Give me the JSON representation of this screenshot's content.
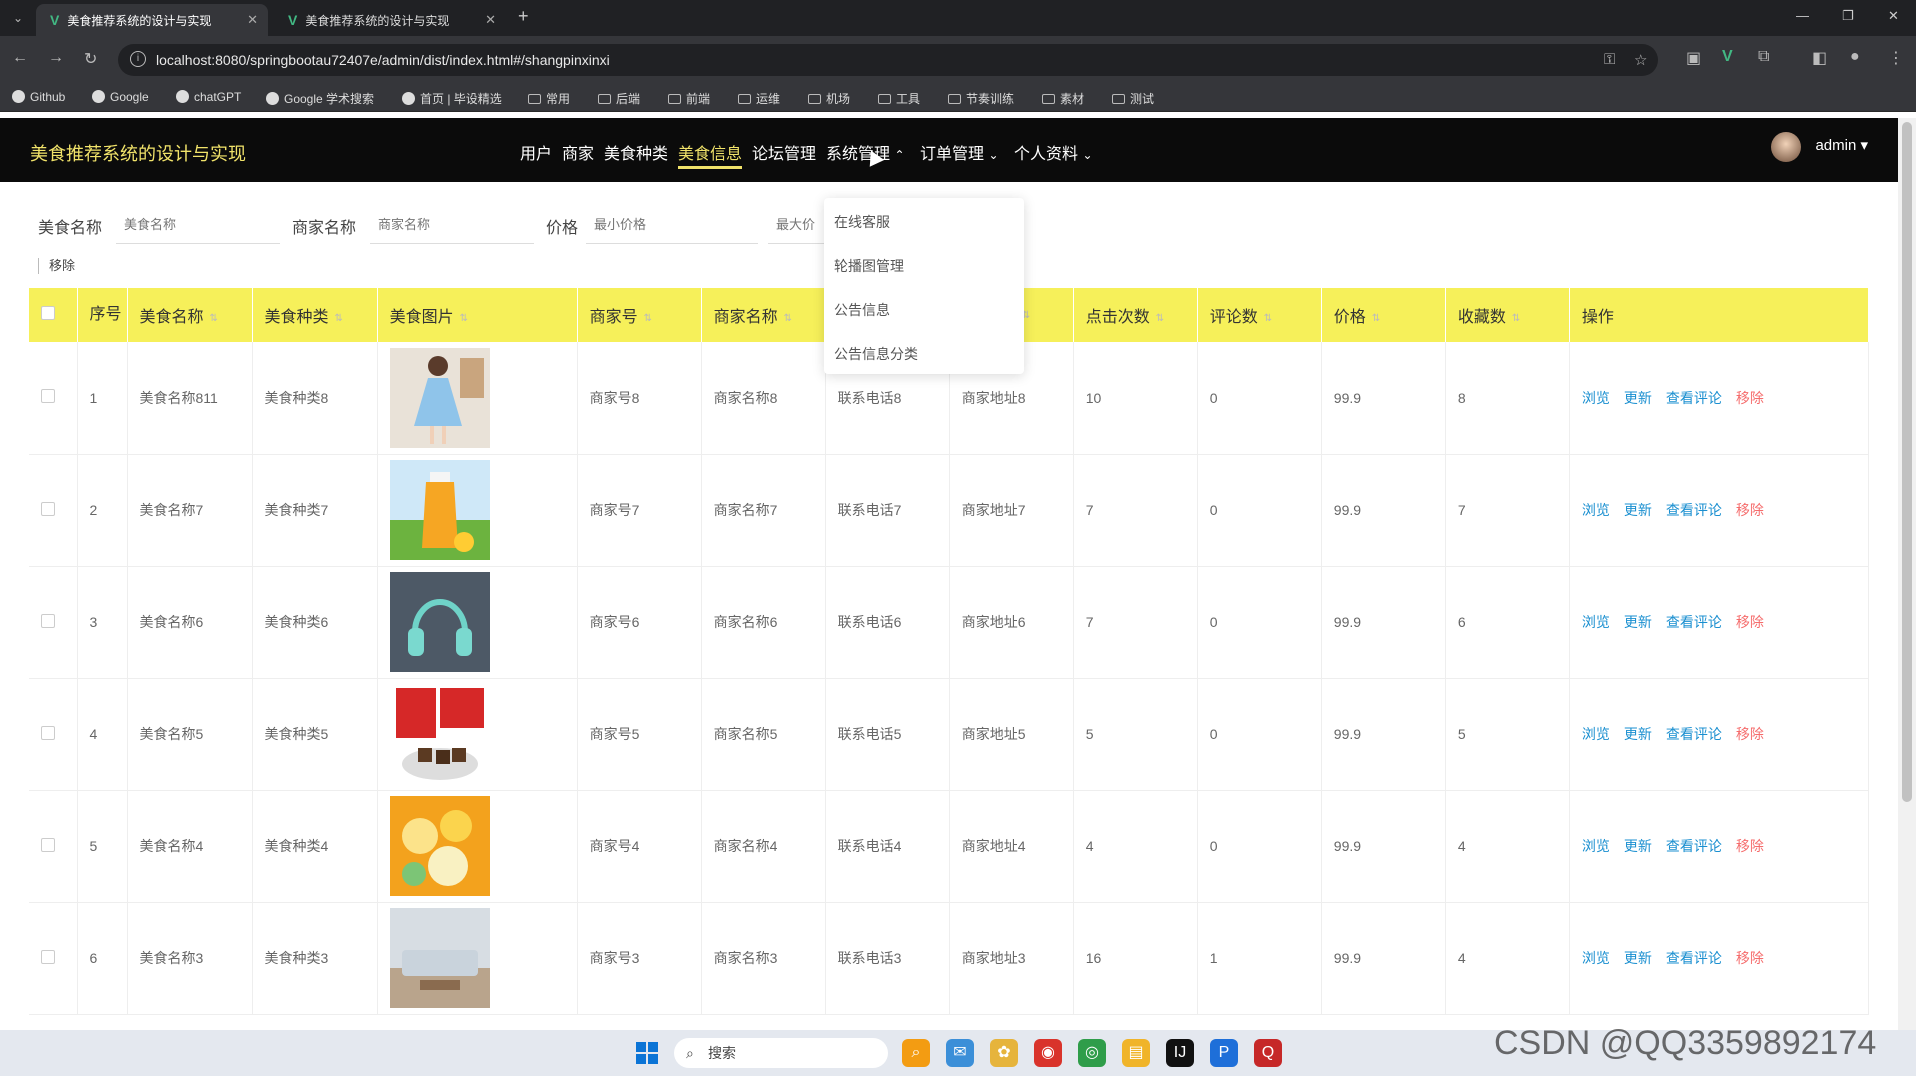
{
  "browser": {
    "tabs": [
      {
        "title": "美食推荐系统的设计与实现",
        "active": true
      },
      {
        "title": "美食推荐系统的设计与实现",
        "active": false
      }
    ],
    "url": "localhost:8080/springbootau72407e/admin/dist/index.html#/shangpinxinxi",
    "bookmarks": [
      "Github",
      "Google",
      "chatGPT",
      "Google 学术搜索",
      "首页 | 毕设精选",
      "常用",
      "后端",
      "前端",
      "运维",
      "机场",
      "工具",
      "节奏训练",
      "素材",
      "测试"
    ]
  },
  "app": {
    "title": "美食推荐系统的设计与实现",
    "nav": [
      {
        "label": "用户"
      },
      {
        "label": "商家"
      },
      {
        "label": "美食种类"
      },
      {
        "label": "美食信息",
        "active": true
      },
      {
        "label": "论坛管理"
      },
      {
        "label": "系统管理",
        "arrow": "⌃"
      },
      {
        "label": "订单管理",
        "arrow": "⌄"
      },
      {
        "label": "个人资料",
        "arrow": "⌄"
      }
    ],
    "user": "admin ▾",
    "dropdown": [
      "在线客服",
      "轮播图管理",
      "公告信息",
      "公告信息分类"
    ]
  },
  "search": {
    "food_label": "美食名称",
    "food_placeholder": "美食名称",
    "shop_label": "商家名称",
    "shop_placeholder": "商家名称",
    "price_label": "价格",
    "min_placeholder": "最小价格",
    "max_placeholder": "最大价"
  },
  "toolbar": {
    "remove": "移除"
  },
  "table": {
    "headers": [
      "序号",
      "美食名称",
      "美食种类",
      "美食图片",
      "商家号",
      "商家名称",
      "",
      "",
      "点击次数",
      "评论数",
      "价格",
      "收藏数",
      "操作"
    ],
    "rows": [
      {
        "no": "1",
        "name": "美食名称811",
        "type": "美食种类8",
        "img": "dress",
        "shop_no": "商家号8",
        "shop": "商家名称8",
        "phone": "联系电话8",
        "addr": "商家地址8",
        "clicks": "10",
        "comments": "0",
        "price": "99.9",
        "fav": "8"
      },
      {
        "no": "2",
        "name": "美食名称7",
        "type": "美食种类7",
        "img": "juice",
        "shop_no": "商家号7",
        "shop": "商家名称7",
        "phone": "联系电话7",
        "addr": "商家地址7",
        "clicks": "7",
        "comments": "0",
        "price": "99.9",
        "fav": "7"
      },
      {
        "no": "3",
        "name": "美食名称6",
        "type": "美食种类6",
        "img": "headphones",
        "shop_no": "商家号6",
        "shop": "商家名称6",
        "phone": "联系电话6",
        "addr": "商家地址6",
        "clicks": "7",
        "comments": "0",
        "price": "99.9",
        "fav": "6"
      },
      {
        "no": "4",
        "name": "美食名称5",
        "type": "美食种类5",
        "img": "chocolate",
        "shop_no": "商家号5",
        "shop": "商家名称5",
        "phone": "联系电话5",
        "addr": "商家地址5",
        "clicks": "5",
        "comments": "0",
        "price": "99.9",
        "fav": "5"
      },
      {
        "no": "5",
        "name": "美食名称4",
        "type": "美食种类4",
        "img": "fruit",
        "shop_no": "商家号4",
        "shop": "商家名称4",
        "phone": "联系电话4",
        "addr": "商家地址4",
        "clicks": "4",
        "comments": "0",
        "price": "99.9",
        "fav": "4"
      },
      {
        "no": "6",
        "name": "美食名称3",
        "type": "美食种类3",
        "img": "sofa",
        "shop_no": "商家号3",
        "shop": "商家名称3",
        "phone": "联系电话3",
        "addr": "商家地址3",
        "clicks": "16",
        "comments": "1",
        "price": "99.9",
        "fav": "4"
      }
    ],
    "actions": [
      "浏览",
      "更新",
      "查看评论",
      "移除"
    ]
  },
  "taskbar": {
    "search": "搜索"
  },
  "watermark": "CSDN @QQ3359892174",
  "colors": {
    "header_bg": "#0b0b0b",
    "accent_yellow": "#f1e36a",
    "table_head": "#f6f05a",
    "link": "#1a8fd0",
    "danger": "#f56c6c"
  }
}
